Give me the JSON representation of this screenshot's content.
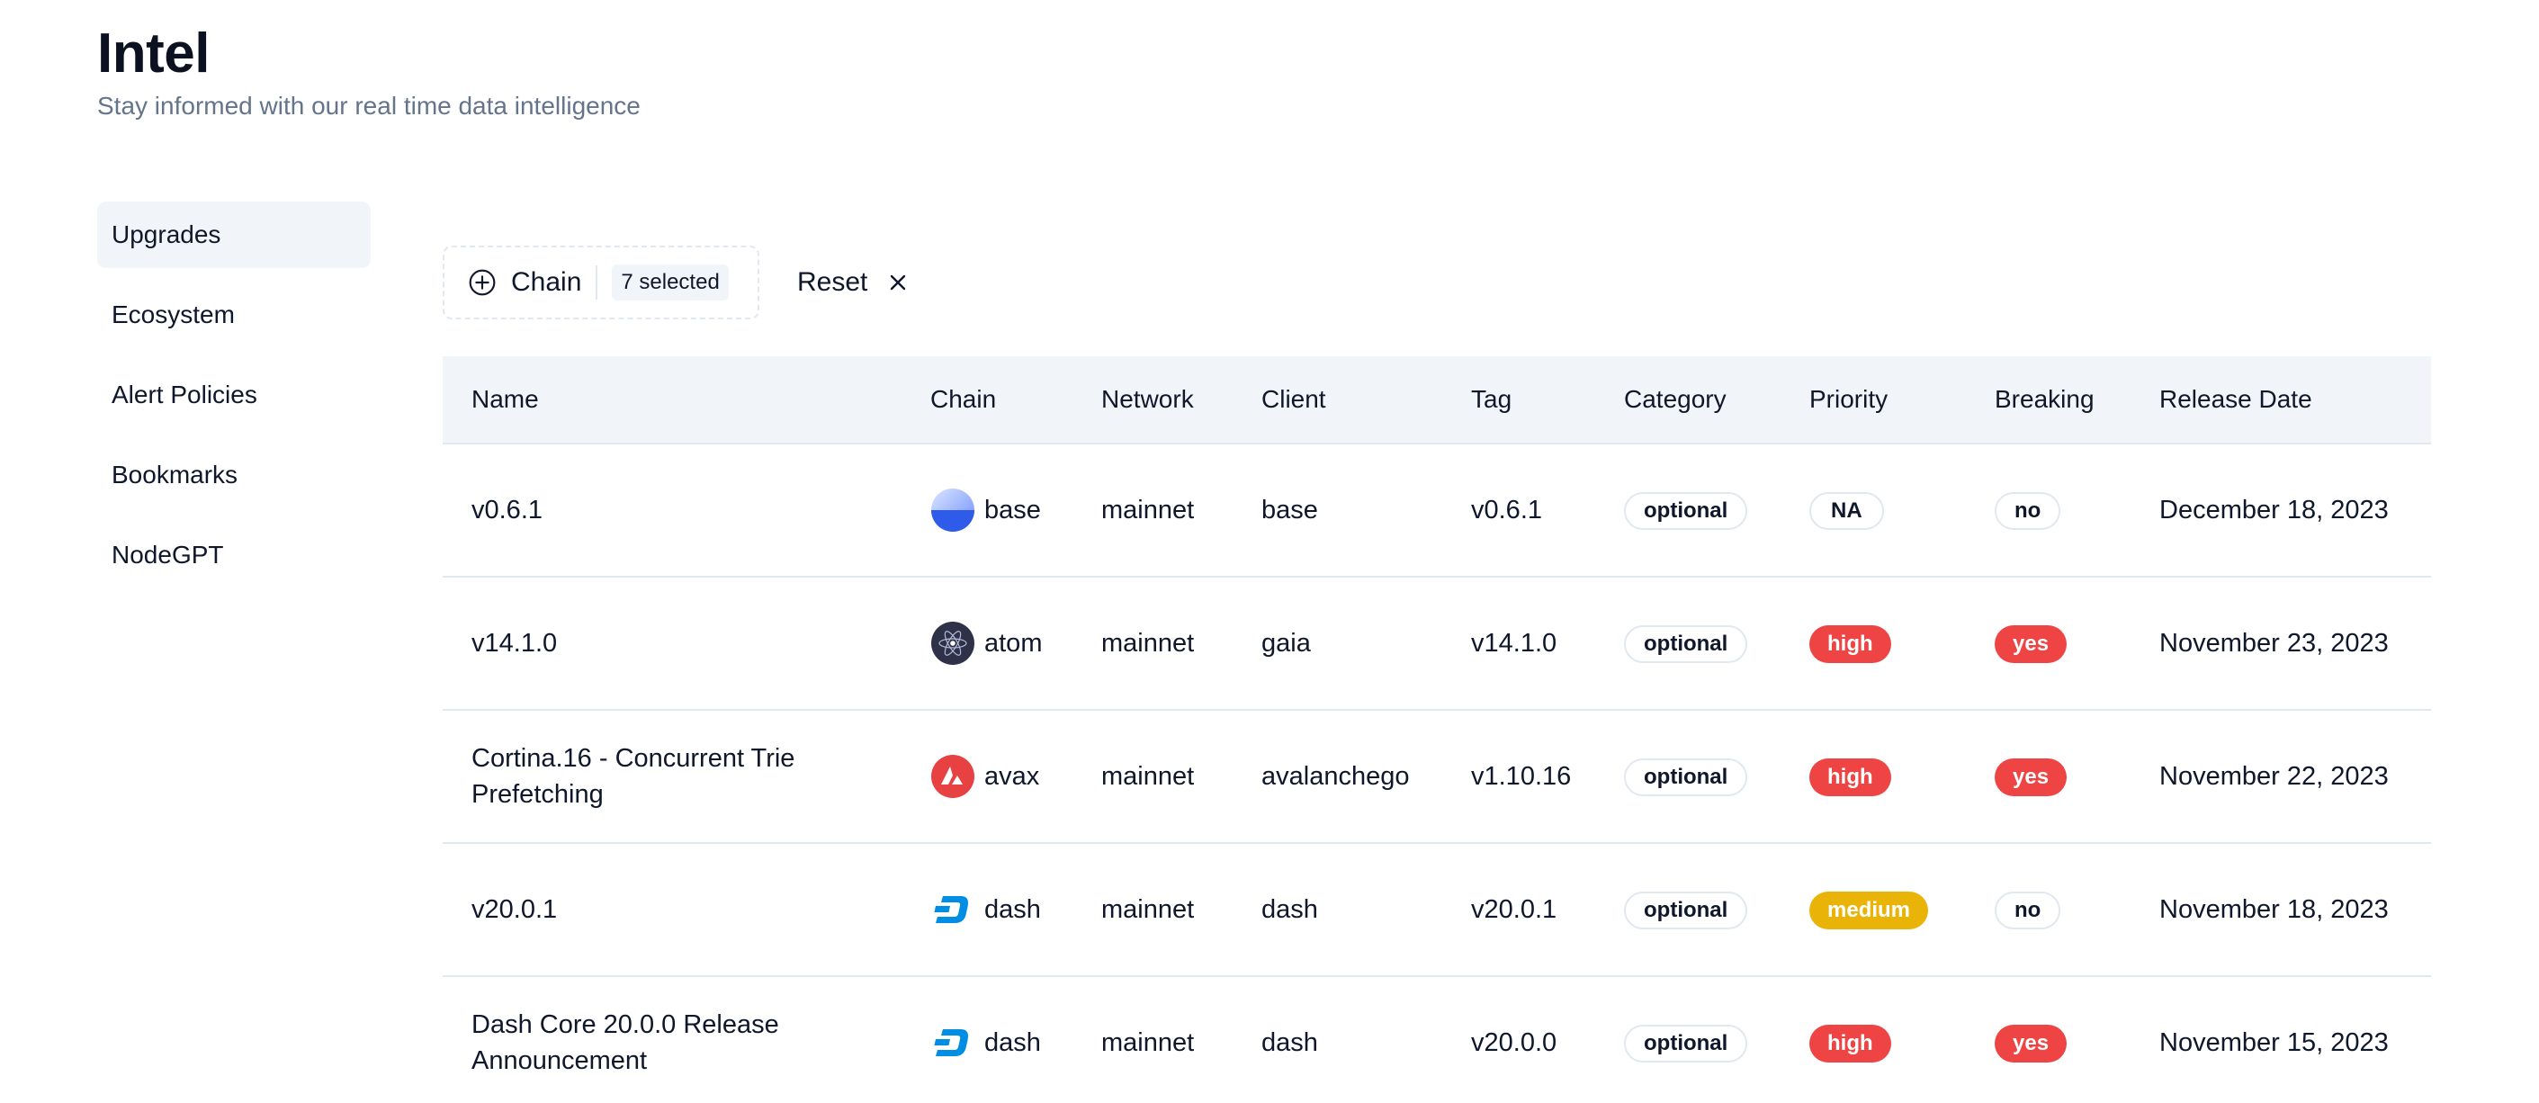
{
  "header": {
    "title": "Intel",
    "subtitle": "Stay informed with our real time data intelligence"
  },
  "sidebar": {
    "items": [
      {
        "label": "Upgrades",
        "active": true
      },
      {
        "label": "Ecosystem"
      },
      {
        "label": "Alert Policies"
      },
      {
        "label": "Bookmarks"
      },
      {
        "label": "NodeGPT"
      }
    ]
  },
  "filters": {
    "chain_label": "Chain",
    "selected_badge": "7 selected",
    "reset_label": "Reset"
  },
  "table": {
    "columns": [
      "Name",
      "Chain",
      "Network",
      "Client",
      "Tag",
      "Category",
      "Priority",
      "Breaking",
      "Release Date"
    ],
    "rows": [
      {
        "name": "v0.6.1",
        "chain": "base",
        "chain_icon": "base-chain-icon",
        "network": "mainnet",
        "client": "base",
        "tag": "v0.6.1",
        "category": "optional",
        "priority": "NA",
        "breaking": "no",
        "release_date": "December 18, 2023"
      },
      {
        "name": "v14.1.0",
        "chain": "atom",
        "chain_icon": "atom-chain-icon",
        "network": "mainnet",
        "client": "gaia",
        "tag": "v14.1.0",
        "category": "optional",
        "priority": "high",
        "breaking": "yes",
        "release_date": "November 23, 2023"
      },
      {
        "name": "Cortina.16 - Concurrent Trie Prefetching",
        "chain": "avax",
        "chain_icon": "avax-chain-icon",
        "network": "mainnet",
        "client": "avalanchego",
        "tag": "v1.10.16",
        "category": "optional",
        "priority": "high",
        "breaking": "yes",
        "release_date": "November 22, 2023"
      },
      {
        "name": "v20.0.1",
        "chain": "dash",
        "chain_icon": "dash-chain-icon",
        "network": "mainnet",
        "client": "dash",
        "tag": "v20.0.1",
        "category": "optional",
        "priority": "medium",
        "breaking": "no",
        "release_date": "November 18, 2023"
      },
      {
        "name": "Dash Core 20.0.0 Release Announcement",
        "chain": "dash",
        "chain_icon": "dash-chain-icon",
        "network": "mainnet",
        "client": "dash",
        "tag": "v20.0.0",
        "category": "optional",
        "priority": "high",
        "breaking": "yes",
        "release_date": "November 15, 2023"
      }
    ]
  },
  "colors": {
    "high": "#ef4444",
    "medium": "#eab308",
    "header_bg": "#f1f5f9",
    "border": "#e2e8f0"
  }
}
